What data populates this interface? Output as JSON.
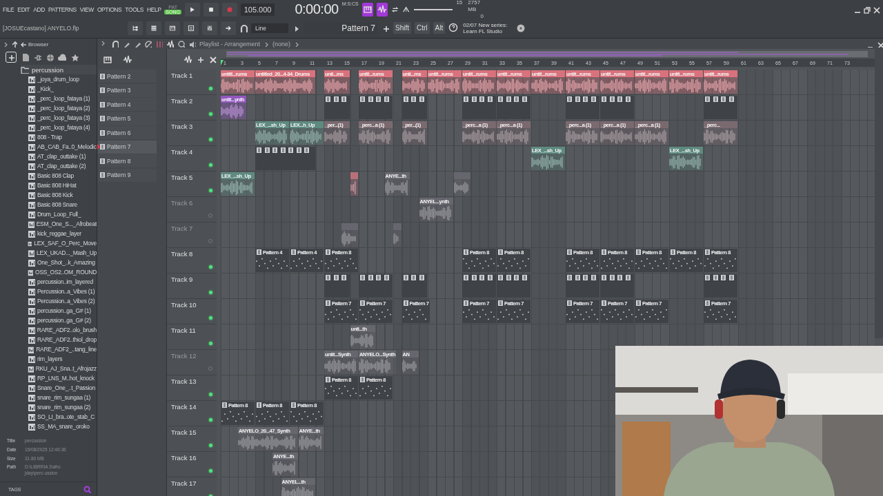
{
  "menu": [
    "FILE",
    "EDIT",
    "ADD",
    "PATTERNS",
    "VIEW",
    "OPTIONS",
    "TOOLS",
    "HELP"
  ],
  "mode_toggle": [
    {
      "label": "PAT",
      "selected": false
    },
    {
      "label": "SONG",
      "selected": true
    }
  ],
  "tempo": "105.000",
  "time": {
    "value": "0:00:00",
    "unit": "M:S:CS"
  },
  "cpu": "15",
  "memory": "2757 MB",
  "polyphony": "0",
  "project": "[JOSUEcastano] ANYELO.flp",
  "snap": "Line",
  "pattern_selector": "Pattern 7",
  "modifiers": [
    "Shift",
    "Ctrl",
    "Alt"
  ],
  "hint": {
    "counter": "02/07",
    "text": "New series: Learn FL Studio"
  },
  "browser": {
    "title": "Browser",
    "folder": "percussion",
    "files": [
      "_joya_drum_loop",
      "_Kick_",
      "_perc_loop_fataya (1)",
      "_perc_loop_fataya (2)",
      "_perc_loop_fataya (3)",
      "_perc_loop_fataya (4)",
      "808 - Trap",
      "AB_CAB_Fa..0_Melodic",
      "AT_clap_outtake (1)",
      "AT_clap_outtake (2)",
      "Basic 808 Clap",
      "Basic 808 HiHat",
      "Basic 808 Kick",
      "Basic 808 Snare",
      "Drum_Loop_Full_",
      "ESM_One_S..._Afrobeat",
      "kick_reggae_layer",
      "LEX_SAF_O_Perc_Move",
      "LEX_UKAD..._Mash_Up",
      "One_Shot_..k_Amazing",
      "OSS_OS2..OM_ROUND",
      "percussion..im_layered",
      "Percussion..a_Vibes (1)",
      "Percussion..a_Vibes (2)",
      "percussion..ga_G# (1)",
      "percussion..ga_G# (2)",
      "RARE_ADF2..olo_brush",
      "RARE_ADF2..thiol_drop",
      "RARE_ADF2_..tang_line",
      "rim_layers",
      "RKU_AJ_Sna..t_Afrojazz",
      "RP_LNS_M..hot_knock",
      "Snare_One_..t_Passion",
      "snare_rim_sungaa (1)",
      "snare_rim_sungaa (2)",
      "SO_LI_bra..ote_stab_C",
      "SS_MA_snare_oroko"
    ],
    "info": [
      {
        "label": "Title",
        "value": "percussion"
      },
      {
        "label": "Date",
        "value": "15/08/2025 12:46:36"
      },
      {
        "label": "Size",
        "value": "31.80 MB"
      },
      {
        "label": "Path",
        "value": "D:\\LIBRRIA 3\\afro jday\\perc-ussion"
      }
    ],
    "tags": "TAGS"
  },
  "playlist": {
    "title": "Playlist - Arrangement",
    "arrangement": "(none)",
    "patterns": [
      {
        "name": "Pattern 2",
        "selected": false
      },
      {
        "name": "Pattern 3",
        "selected": false
      },
      {
        "name": "Pattern 4",
        "selected": false
      },
      {
        "name": "Pattern 5",
        "selected": false
      },
      {
        "name": "Pattern 6",
        "selected": false
      },
      {
        "name": "Pattern 7",
        "selected": true
      },
      {
        "name": "Pattern 8",
        "selected": false
      },
      {
        "name": "Pattern 9",
        "selected": false
      }
    ],
    "ruler": [
      "1",
      "3",
      "5",
      "7",
      "9",
      "11",
      "13",
      "15",
      "17",
      "19",
      "21",
      "23",
      "25",
      "27",
      "29",
      "31",
      "33",
      "35",
      "37",
      "39",
      "41",
      "43",
      "45",
      "47",
      "49",
      "51",
      "53",
      "55",
      "57",
      "59",
      "61",
      "63",
      "65",
      "67",
      "69",
      "71",
      "73"
    ],
    "tracks": [
      {
        "name": "Track 1",
        "muted": false,
        "clips": [
          {
            "kind": "audio",
            "color": "#d9727c",
            "label": "untitl...rums"
          },
          {
            "kind": "audio",
            "color": "#d9727c",
            "label": "untitled_20...4-34_Drums"
          },
          {
            "kind": "audio",
            "color": "#d9727c",
            "label": "unti...ms"
          },
          {
            "kind": "audio",
            "color": "#d9727c",
            "label": "untit...rums"
          },
          {
            "kind": "audio",
            "color": "#d9727c",
            "label": "unti...ms"
          },
          {
            "kind": "audio",
            "color": "#d9727c",
            "label": "untit...rums"
          },
          {
            "kind": "audio",
            "color": "#d9727c",
            "label": "untit...rums"
          },
          {
            "kind": "audio",
            "color": "#d9727c",
            "label": "untit...rums"
          },
          {
            "kind": "audio",
            "color": "#d9727c",
            "label": "untit...rums"
          },
          {
            "kind": "audio",
            "color": "#d9727c",
            "label": "untit...rums"
          },
          {
            "kind": "audio",
            "color": "#d9727c",
            "label": "untit...rums"
          },
          {
            "kind": "audio",
            "color": "#d9727c",
            "label": "untit...rums"
          },
          {
            "kind": "audio",
            "color": "#d9727c",
            "label": "untit...rums"
          },
          {
            "kind": "audio",
            "color": "#d9727c",
            "label": "untit...rums"
          }
        ]
      },
      {
        "name": "Track 2",
        "muted": false,
        "clips": [
          {
            "kind": "audio",
            "color": "#9358c0",
            "label": "untit...ynth"
          },
          {
            "kind": "pattern",
            "color": "#3f4247"
          },
          {
            "kind": "pattern",
            "color": "#3f4247"
          },
          {
            "kind": "pattern",
            "color": "#3f4247"
          },
          {
            "kind": "pattern",
            "color": "#3f4247"
          },
          {
            "kind": "pattern",
            "color": "#3f4247"
          },
          {
            "kind": "pattern",
            "color": "#3f4247"
          },
          {
            "kind": "pattern",
            "color": "#3f4247"
          },
          {
            "kind": "pattern",
            "color": "#3f4247"
          }
        ]
      },
      {
        "name": "Track 3",
        "muted": false,
        "clips": [
          {
            "kind": "audio",
            "color": "#5e8a7f",
            "label": "LEX_...sh_Up"
          },
          {
            "kind": "audio",
            "color": "#5e8a7f",
            "label": "LEX...h_Up"
          },
          {
            "kind": "audio",
            "color": "#7a6a70",
            "label": "_per...(1)"
          },
          {
            "kind": "audio",
            "color": "#7a6a70",
            "label": "_perc...a (1)"
          },
          {
            "kind": "audio",
            "color": "#7a6a70",
            "label": "_per...(1)"
          },
          {
            "kind": "audio",
            "color": "#7a6a70",
            "label": "_perc...a (1)"
          },
          {
            "kind": "audio",
            "color": "#7a6a70",
            "label": "_perc...a (1)"
          },
          {
            "kind": "audio",
            "color": "#7a6a70",
            "label": "_perc...a (1)"
          },
          {
            "kind": "audio",
            "color": "#7a6a70",
            "label": "_perc...a (1)"
          },
          {
            "kind": "audio",
            "color": "#7a6a70",
            "label": "_perc...a (1)"
          },
          {
            "kind": "audio",
            "color": "#7a6a70",
            "label": "_perc..."
          }
        ]
      },
      {
        "name": "Track 4",
        "muted": false,
        "clips": [
          {
            "kind": "pattern",
            "color": "#3f4247"
          },
          {
            "kind": "audio",
            "color": "#5e8a7f",
            "label": "LEX_...sh_Up"
          },
          {
            "kind": "audio",
            "color": "#5e8a7f",
            "label": "LEX_...sh_Up"
          }
        ]
      },
      {
        "name": "Track 5",
        "muted": false,
        "clips": [
          {
            "kind": "audio",
            "color": "#5e8a7f",
            "label": "LEX_...sh_Up"
          },
          {
            "kind": "audio",
            "color": "#b7707a"
          },
          {
            "kind": "audio",
            "color": "#66666e",
            "label": "ANYE...th"
          },
          {
            "kind": "audio",
            "color": "#66666e"
          }
        ]
      },
      {
        "name": "Track 6",
        "muted": true,
        "clips": [
          {
            "kind": "audio",
            "color": "#66666e",
            "label": "ANYEL...ynth"
          }
        ]
      },
      {
        "name": "Track 7",
        "muted": true,
        "clips": [
          {
            "kind": "audio",
            "color": "#66666e"
          },
          {
            "kind": "audio",
            "color": "#66666e"
          }
        ]
      },
      {
        "name": "Track 8",
        "muted": false,
        "clips": [
          {
            "kind": "pattern",
            "color": "#3f4247",
            "label": "Pattern 4"
          },
          {
            "kind": "pattern",
            "color": "#3f4247",
            "label": "Pattern 4"
          },
          {
            "kind": "pattern",
            "color": "#3f4247",
            "label": "Pattern 8"
          },
          {
            "kind": "pattern",
            "color": "#3f4247",
            "label": "Pattern 8"
          },
          {
            "kind": "pattern",
            "color": "#3f4247",
            "label": "Pattern 8"
          },
          {
            "kind": "pattern",
            "color": "#3f4247",
            "label": "Pattern 8"
          },
          {
            "kind": "pattern",
            "color": "#3f4247",
            "label": "Pattern 8"
          },
          {
            "kind": "pattern",
            "color": "#3f4247",
            "label": "Pattern 8"
          },
          {
            "kind": "pattern",
            "color": "#3f4247",
            "label": "Pattern 8"
          },
          {
            "kind": "pattern",
            "color": "#3f4247",
            "label": "Pattern 8"
          }
        ]
      },
      {
        "name": "Track 9",
        "muted": false,
        "clips": [
          {
            "kind": "pattern",
            "color": "#3f4247"
          },
          {
            "kind": "pattern",
            "color": "#3f4247"
          },
          {
            "kind": "pattern",
            "color": "#3f4247"
          },
          {
            "kind": "pattern",
            "color": "#3f4247"
          },
          {
            "kind": "pattern",
            "color": "#3f4247"
          },
          {
            "kind": "pattern",
            "color": "#3f4247"
          },
          {
            "kind": "pattern",
            "color": "#3f4247"
          },
          {
            "kind": "pattern",
            "color": "#3f4247"
          }
        ]
      },
      {
        "name": "Track 10",
        "muted": false,
        "clips": [
          {
            "kind": "pattern",
            "color": "#3f4247",
            "label": "Pattern 7"
          },
          {
            "kind": "pattern",
            "color": "#3f4247",
            "label": "Pattern 7"
          },
          {
            "kind": "pattern",
            "color": "#3f4247",
            "label": "Pattern 7"
          },
          {
            "kind": "pattern",
            "color": "#3f4247",
            "label": "Pattern 7"
          },
          {
            "kind": "pattern",
            "color": "#3f4247",
            "label": "Pattern 7"
          },
          {
            "kind": "pattern",
            "color": "#3f4247",
            "label": "Pattern 7"
          },
          {
            "kind": "pattern",
            "color": "#3f4247",
            "label": "Pattern 7"
          },
          {
            "kind": "pattern",
            "color": "#3f4247",
            "label": "Pattern 7"
          },
          {
            "kind": "pattern",
            "color": "#3f4247",
            "label": "Pattern 7"
          }
        ]
      },
      {
        "name": "Track 11",
        "muted": false,
        "clips": [
          {
            "kind": "audio",
            "color": "#66666e",
            "label": "unti...th"
          }
        ]
      },
      {
        "name": "Track 12",
        "muted": true,
        "clips": [
          {
            "kind": "audio",
            "color": "#66666e",
            "label": "untit...Synth"
          },
          {
            "kind": "audio",
            "color": "#66666e",
            "label": "ANYELO...Synth"
          },
          {
            "kind": "audio",
            "color": "#66666e",
            "label": "AN"
          }
        ]
      },
      {
        "name": "Track 13",
        "muted": false,
        "clips": [
          {
            "kind": "pattern",
            "color": "#3f4247",
            "label": "Pattern 8"
          },
          {
            "kind": "pattern",
            "color": "#3f4247",
            "label": "Pattern 8"
          }
        ]
      },
      {
        "name": "Track 14",
        "muted": false,
        "clips": [
          {
            "kind": "pattern",
            "color": "#3f4247",
            "label": "Pattern 8"
          },
          {
            "kind": "pattern",
            "color": "#3f4247",
            "label": "Pattern 8"
          },
          {
            "kind": "pattern",
            "color": "#3f4247",
            "label": "Pattern 8"
          }
        ]
      },
      {
        "name": "Track 15",
        "muted": false,
        "clips": [
          {
            "kind": "audio",
            "color": "#66666e",
            "label": "ANYELO_20...47_Synth"
          },
          {
            "kind": "audio",
            "color": "#66666e",
            "label": "ANYE...th"
          }
        ]
      },
      {
        "name": "Track 16",
        "muted": false,
        "clips": [
          {
            "kind": "audio",
            "color": "#66666e",
            "label": "ANYE...th"
          }
        ]
      },
      {
        "name": "Track 17",
        "muted": false,
        "clips": [
          {
            "kind": "audio",
            "color": "#66666e",
            "label": "ANYEL...th"
          }
        ]
      }
    ]
  },
  "webcam": {
    "kind": "picture"
  }
}
